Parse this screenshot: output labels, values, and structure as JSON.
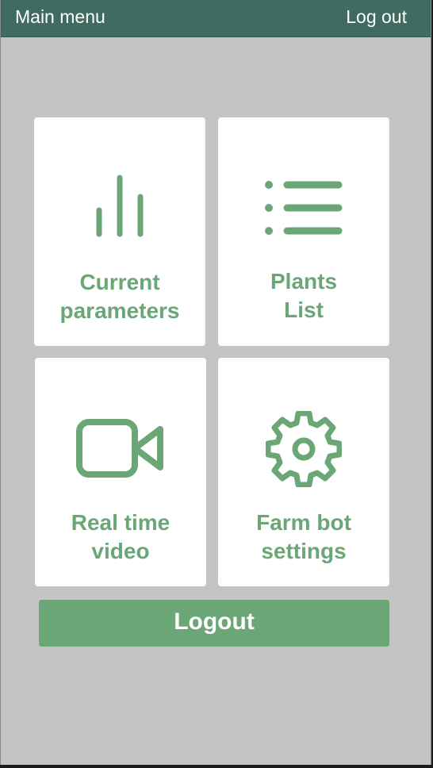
{
  "topbar": {
    "left_link": "Main menu",
    "right_link": "Log out"
  },
  "tiles": [
    {
      "icon": "bar-chart-icon",
      "line1": "Current",
      "line2": "parameters"
    },
    {
      "icon": "list-icon",
      "line1": "Plants",
      "line2": "List"
    },
    {
      "icon": "video-camera-icon",
      "line1": "Real time",
      "line2": "video"
    },
    {
      "icon": "gear-icon",
      "line1": "Farm bot",
      "line2": "settings"
    }
  ],
  "logout_button": "Logout",
  "colors": {
    "topbar": "#3f6b60",
    "accent": "#6aa676",
    "background": "#c4c4c4",
    "tile": "#ffffff"
  }
}
